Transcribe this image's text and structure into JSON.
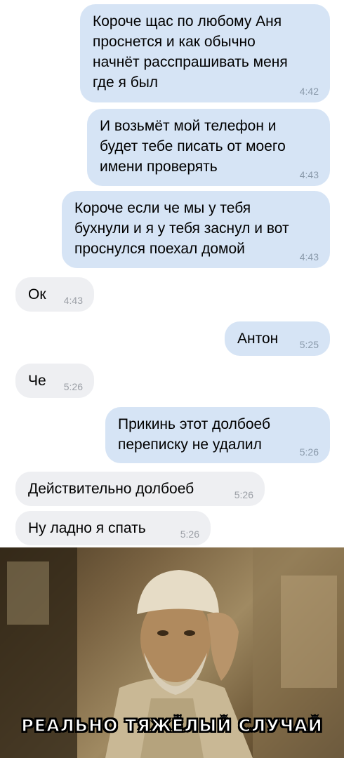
{
  "messages": [
    {
      "text": "Короче щас по любому Аня\nпроснется и как обычно\nначнёт расспрашивать меня\nгде я был",
      "time": "4:42"
    },
    {
      "text": "И возьмёт мой телефон и\nбудет тебе писать от моего\nимени проверять",
      "time": "4:43"
    },
    {
      "text": "Короче если че мы у тебя\nбухнули и я у тебя заснул и вот\nпроснулся поехал домой",
      "time": "4:43"
    },
    {
      "text": "Ок",
      "time": "4:43"
    },
    {
      "text": "Антон",
      "time": "5:25"
    },
    {
      "text": "Че",
      "time": "5:26"
    },
    {
      "text": "Прикинь этот долбоеб\nпереписку не удалил",
      "time": "5:26"
    },
    {
      "text": "Действительно долбоеб",
      "time": "5:26"
    },
    {
      "text": "Ну ладно я спать",
      "time": "5:26"
    }
  ],
  "meme": {
    "caption": "РЕАЛЬНО ТЯЖЁЛЫЙ СЛУЧАЙ"
  },
  "colors": {
    "outgoing_bubble": "#d6e4f5",
    "incoming_bubble": "#eeeff2",
    "time_text": "#8a9aab"
  }
}
